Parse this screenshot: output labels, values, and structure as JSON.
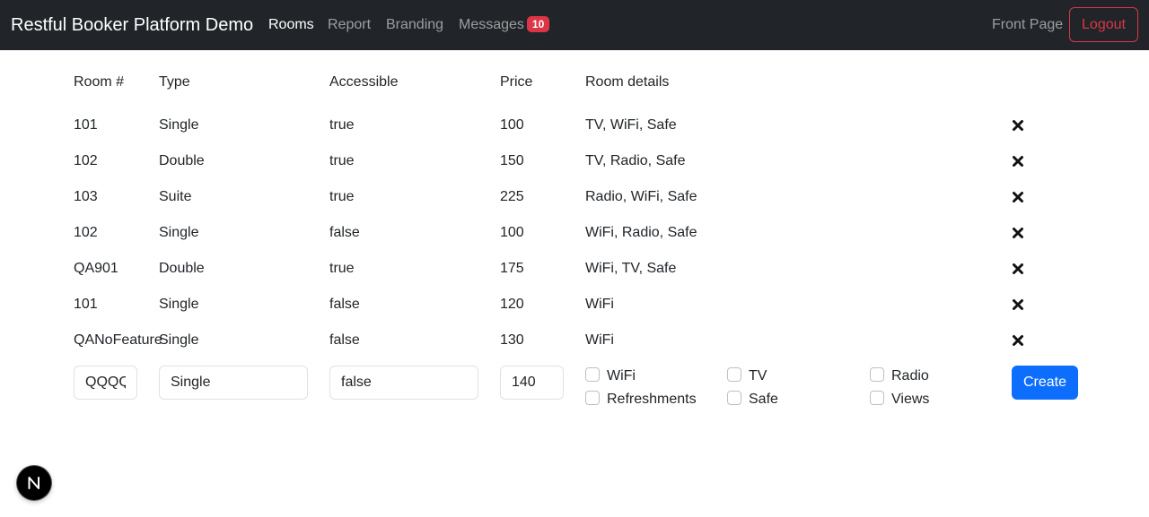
{
  "navbar": {
    "brand": "Restful Booker Platform Demo",
    "links": [
      {
        "label": "Rooms",
        "active": true
      },
      {
        "label": "Report",
        "active": false
      },
      {
        "label": "Branding",
        "active": false
      },
      {
        "label": "Messages",
        "active": false
      }
    ],
    "messages_count": "10",
    "front_page": "Front Page",
    "logout": "Logout"
  },
  "table": {
    "headers": [
      "Room #",
      "Type",
      "Accessible",
      "Price",
      "Room details"
    ],
    "rows": [
      {
        "room": "101",
        "type": "Single",
        "accessible": "true",
        "price": "100",
        "details": "TV, WiFi, Safe"
      },
      {
        "room": "102",
        "type": "Double",
        "accessible": "true",
        "price": "150",
        "details": "TV, Radio, Safe"
      },
      {
        "room": "103",
        "type": "Suite",
        "accessible": "true",
        "price": "225",
        "details": "Radio, WiFi, Safe"
      },
      {
        "room": "102",
        "type": "Single",
        "accessible": "false",
        "price": "100",
        "details": "WiFi, Radio, Safe"
      },
      {
        "room": "QA901",
        "type": "Double",
        "accessible": "true",
        "price": "175",
        "details": "WiFi, TV, Safe"
      },
      {
        "room": "101",
        "type": "Single",
        "accessible": "false",
        "price": "120",
        "details": "WiFi"
      },
      {
        "room": "QANoFeature",
        "type": "Single",
        "accessible": "false",
        "price": "130",
        "details": "WiFi"
      }
    ]
  },
  "form": {
    "room_value": "QQQQ",
    "type_value": "Single",
    "accessible_value": "false",
    "price_value": "140",
    "features": [
      "WiFi",
      "TV",
      "Radio",
      "Refreshments",
      "Safe",
      "Views"
    ],
    "create_label": "Create"
  },
  "colors": {
    "navbar_bg": "#212529",
    "badge": "#dc3545",
    "primary": "#0d6efd"
  },
  "icons": {
    "delete": "x-mark-icon",
    "dev_badge": "n-logo-icon"
  }
}
